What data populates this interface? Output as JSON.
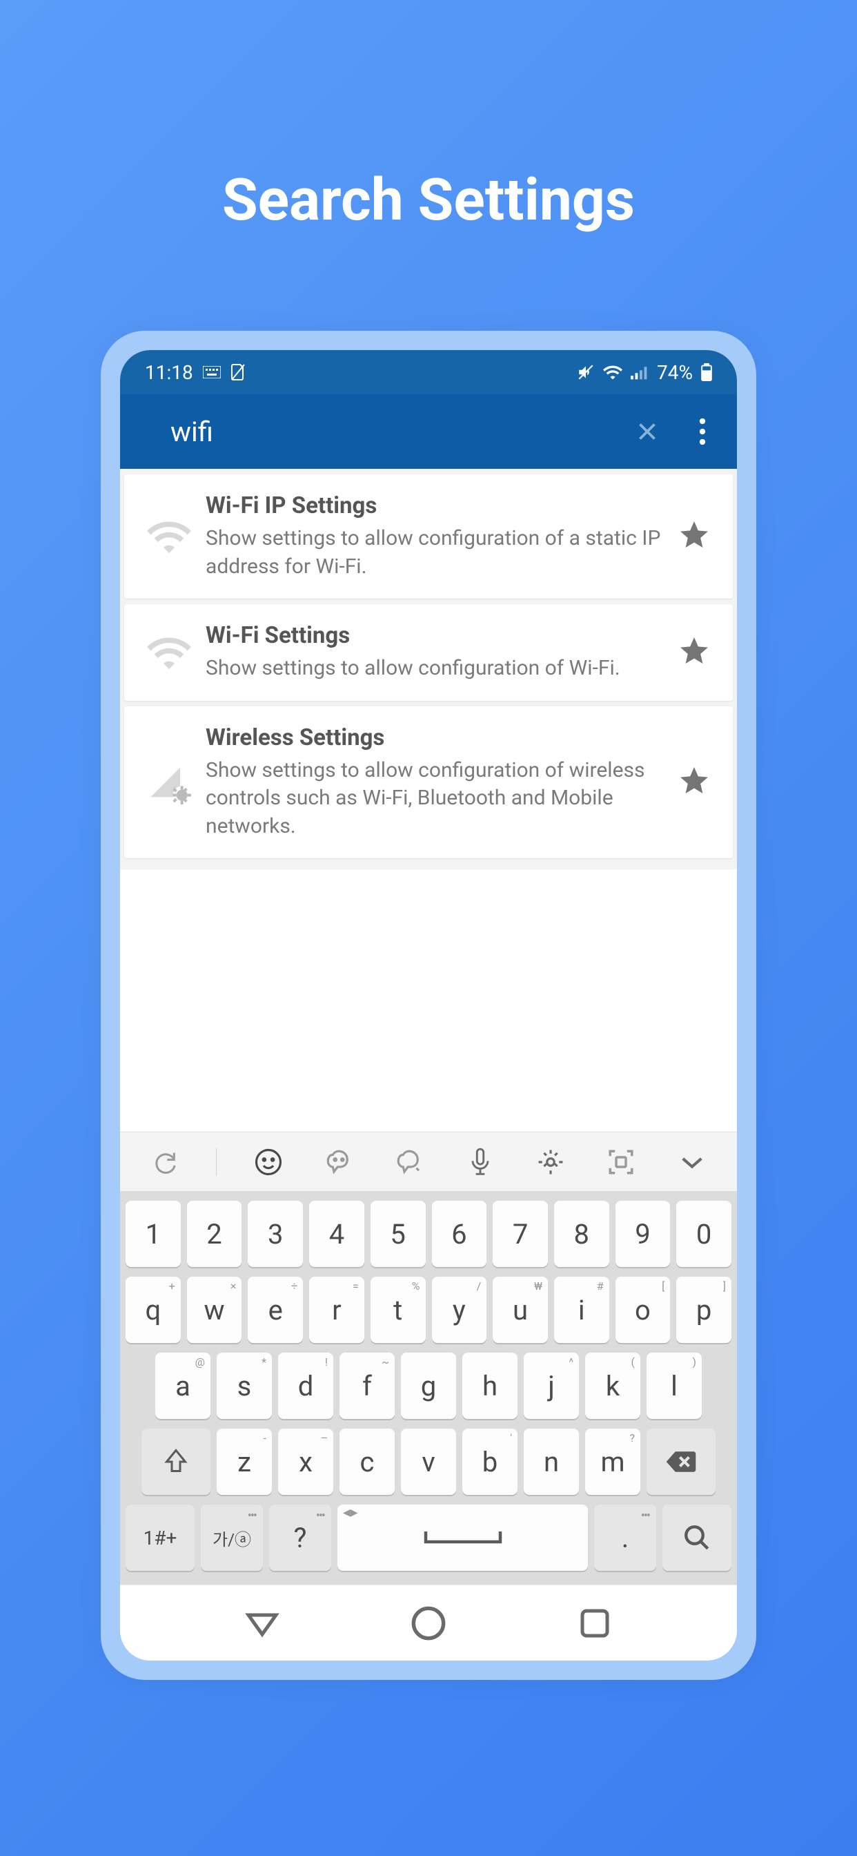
{
  "page_title": "Search Settings",
  "status_bar": {
    "time": "11:18",
    "battery_pct": "74%"
  },
  "search": {
    "query": "wifi"
  },
  "results": [
    {
      "icon": "wifi",
      "title": "Wi-Fi IP Settings",
      "desc": "Show settings to allow configuration of a static IP address for Wi-Fi."
    },
    {
      "icon": "wifi",
      "title": "Wi-Fi Settings",
      "desc": "Show settings to allow configuration of Wi-Fi."
    },
    {
      "icon": "signal-gear",
      "title": "Wireless Settings",
      "desc": "Show settings to allow configuration of wireless controls such as Wi-Fi, Bluetooth and Mobile networks."
    }
  ],
  "keyboard": {
    "row1": [
      "1",
      "2",
      "3",
      "4",
      "5",
      "6",
      "7",
      "8",
      "9",
      "0"
    ],
    "row2": [
      {
        "k": "q",
        "s": "+"
      },
      {
        "k": "w",
        "s": "×"
      },
      {
        "k": "e",
        "s": "÷"
      },
      {
        "k": "r",
        "s": "="
      },
      {
        "k": "t",
        "s": "%"
      },
      {
        "k": "y",
        "s": "/"
      },
      {
        "k": "u",
        "s": "₩"
      },
      {
        "k": "i",
        "s": "#"
      },
      {
        "k": "o",
        "s": "["
      },
      {
        "k": "p",
        "s": "]"
      }
    ],
    "row3": [
      {
        "k": "a",
        "s": "@"
      },
      {
        "k": "s",
        "s": "*"
      },
      {
        "k": "d",
        "s": "!"
      },
      {
        "k": "f",
        "s": "~"
      },
      {
        "k": "g",
        "s": ""
      },
      {
        "k": "h",
        "s": ""
      },
      {
        "k": "j",
        "s": "^"
      },
      {
        "k": "k",
        "s": "("
      },
      {
        "k": "l",
        "s": ")"
      }
    ],
    "row4": [
      {
        "k": "z",
        "s": "-"
      },
      {
        "k": "x",
        "s": "–"
      },
      {
        "k": "c",
        "s": ""
      },
      {
        "k": "v",
        "s": ""
      },
      {
        "k": "b",
        "s": "'"
      },
      {
        "k": "n",
        "s": ""
      },
      {
        "k": "m",
        "s": "?"
      }
    ],
    "bottom": {
      "symbols": "1#+",
      "lang": "가/ⓐ",
      "question": "?",
      "period": "."
    }
  }
}
